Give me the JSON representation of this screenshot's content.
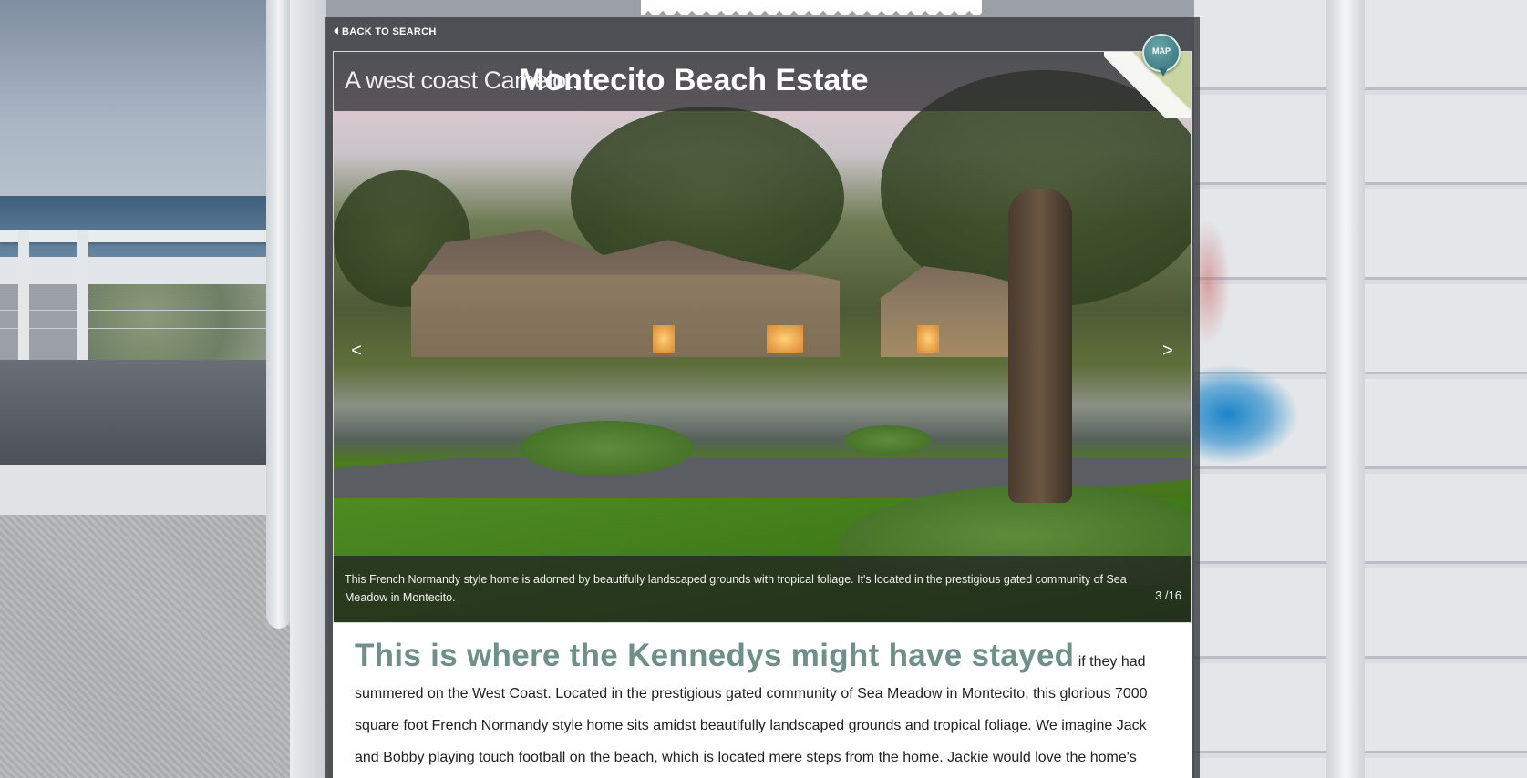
{
  "nav": {
    "back_label": "BACK TO SEARCH",
    "map_label": "MAP"
  },
  "hero": {
    "title_prefix": "A west coast Camelot:",
    "title_main": "Montecito Beach Estate",
    "prev_label": "<",
    "next_label": ">",
    "caption": "This French Normandy style home is adorned by beautifully landscaped grounds with tropical foliage. It's located in the prestigious gated community of Sea Meadow in Montecito.",
    "counter": "3 /16"
  },
  "article": {
    "headline": "This is where the Kennedys might have stayed",
    "body": " if they had summered on the West Coast. Located in the prestigious gated community of Sea Meadow in Montecito, this glorious 7000 square foot French Normandy style home sits amidst beautifully landscaped grounds and tropical foliage. We imagine Jack and Bobby playing touch football on the beach, which is located mere steps from the home. Jackie would love the home's"
  },
  "colors": {
    "headline": "#6f8f89",
    "panel": "#3c3e42",
    "map_pin": "#2f6f74"
  }
}
